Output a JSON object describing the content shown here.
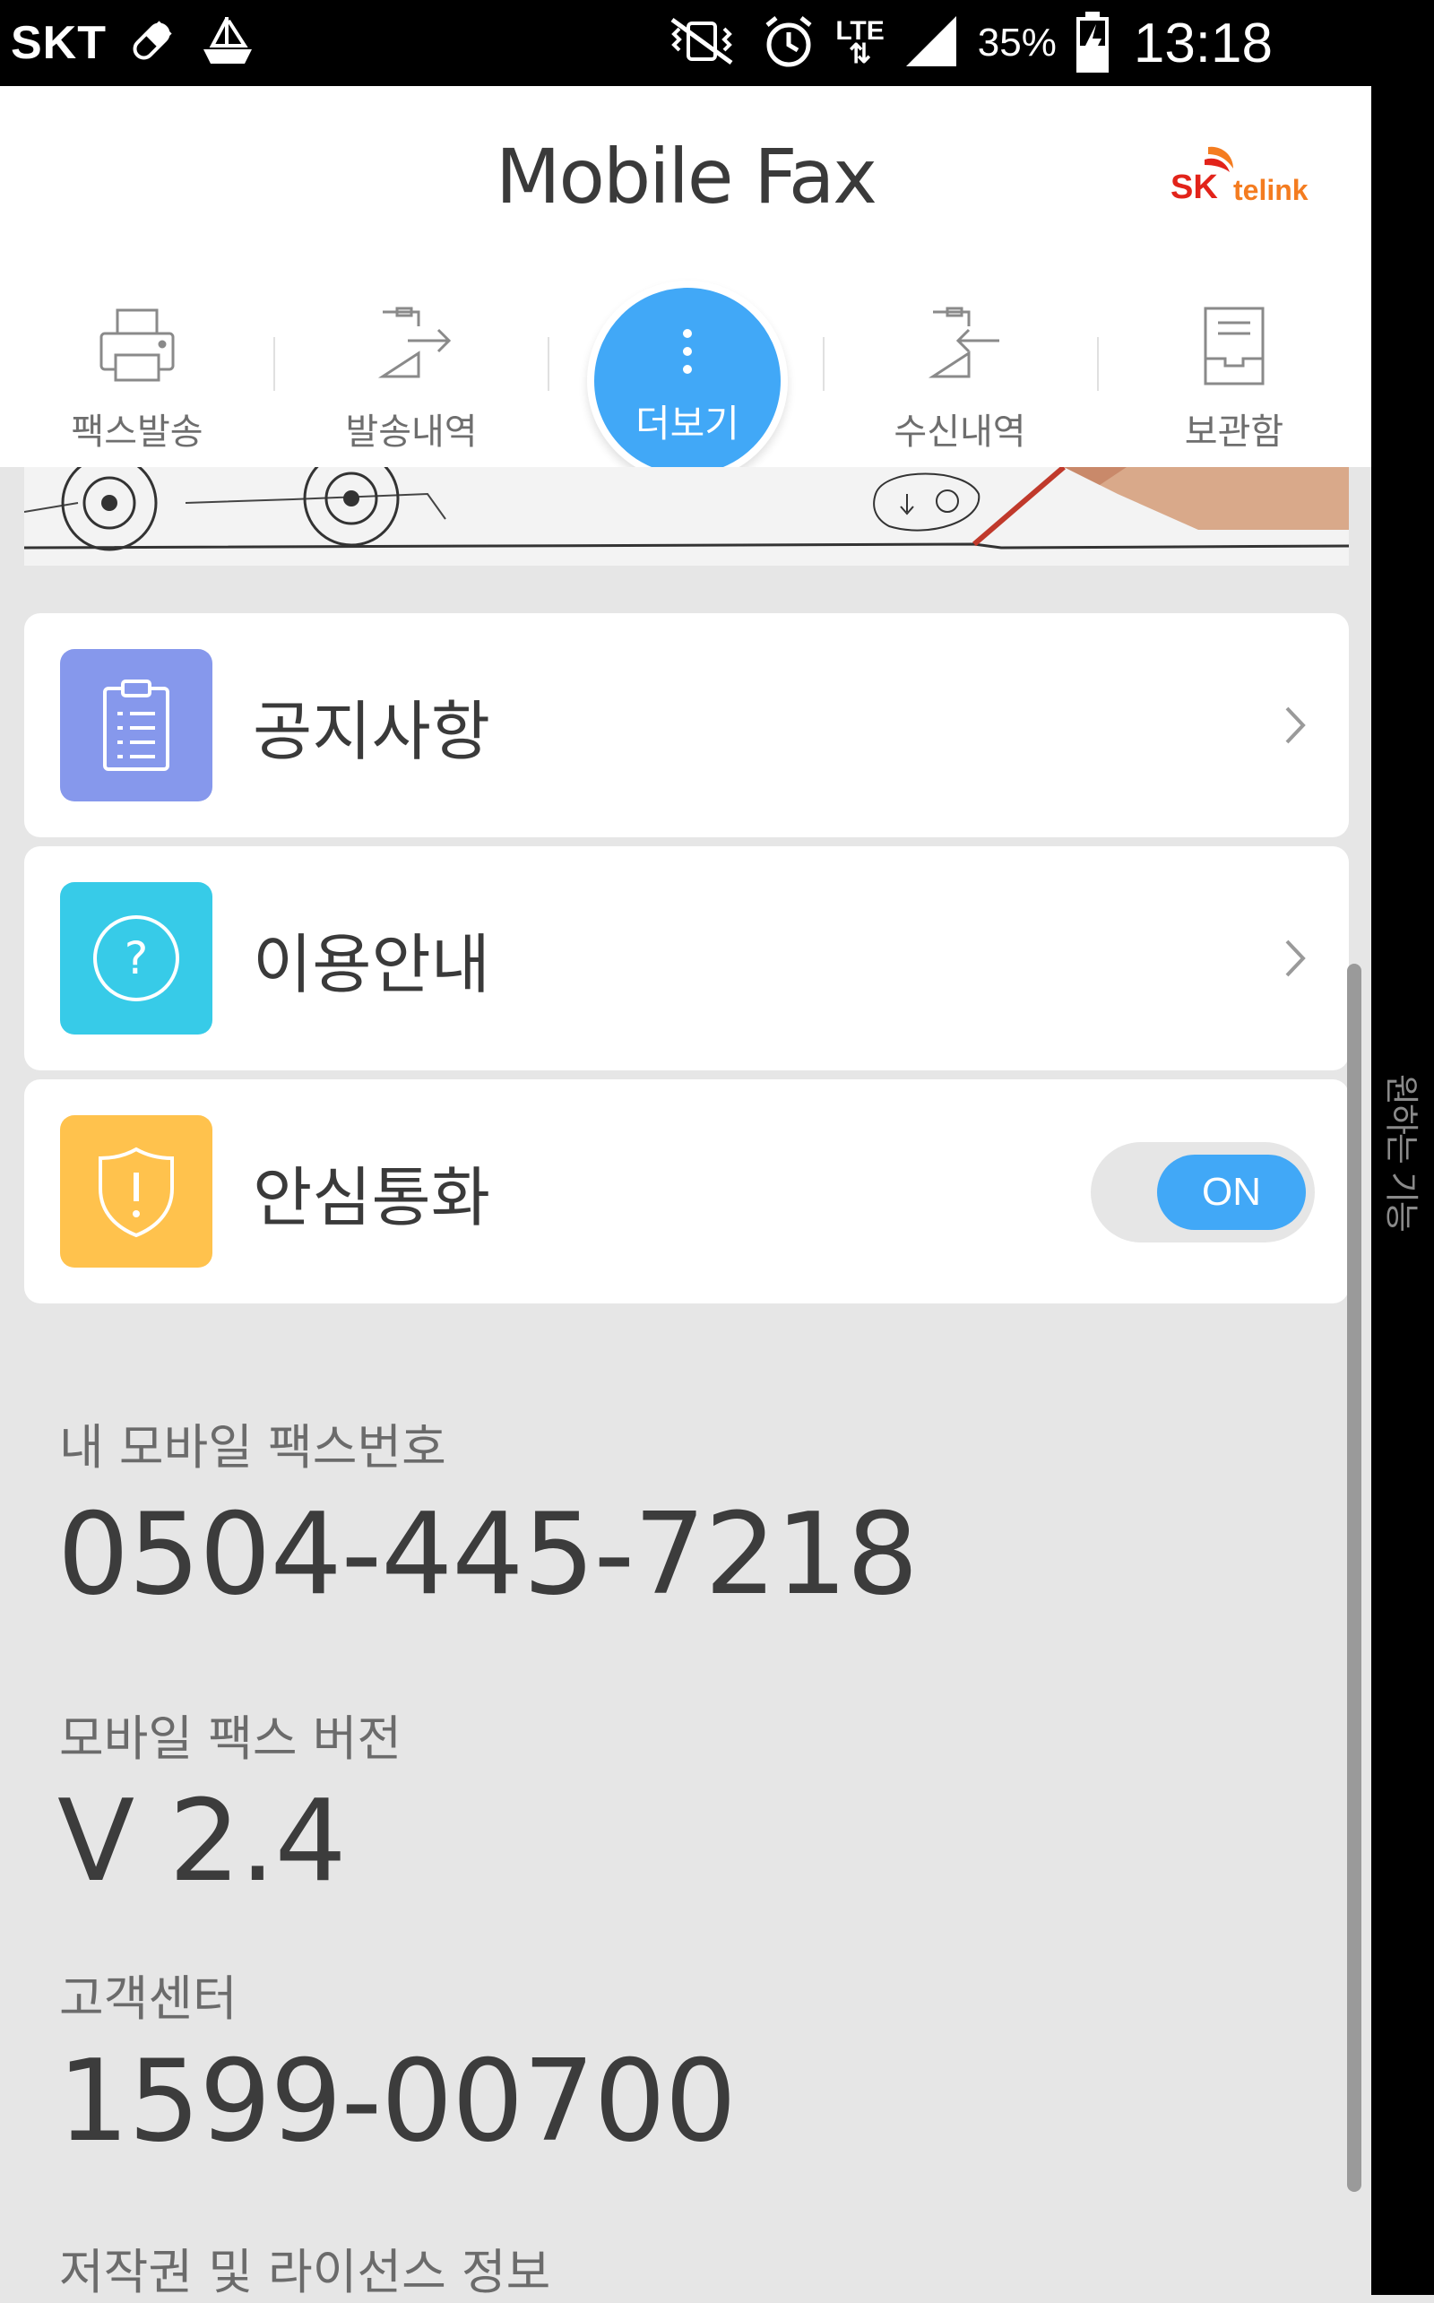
{
  "status_bar": {
    "carrier": "SKT",
    "network": "LTE",
    "battery": "35%",
    "time": "13:18"
  },
  "side_handle_label": "원하는 기능",
  "header": {
    "title": "Mobile Fax",
    "logo_text_sk": "SK",
    "logo_text_telink": "telink"
  },
  "tabs": [
    {
      "label": "팩스발송",
      "icon": "printer-icon"
    },
    {
      "label": "발송내역",
      "icon": "outbox-icon"
    },
    {
      "label": "더보기",
      "icon": "more-vertical-icon",
      "active": true
    },
    {
      "label": "수신내역",
      "icon": "inbox-icon"
    },
    {
      "label": "보관함",
      "icon": "archive-icon"
    }
  ],
  "menu": [
    {
      "label": "공지사항",
      "icon": "clipboard-icon",
      "color": "#8698ec"
    },
    {
      "label": "이용안내",
      "icon": "help-circle-icon",
      "color": "#37cbe8"
    },
    {
      "label": "안심통화",
      "icon": "shield-alert-icon",
      "color": "#ffc24d",
      "toggle": "ON"
    }
  ],
  "info": {
    "fax_number_label": "내 모바일 팩스번호",
    "fax_number": "0504-445-7218",
    "version_label": "모바일 팩스 버전",
    "version": "V 2.4",
    "support_label": "고객센터",
    "support_number": "1599-00700",
    "license_label": "저작권 및 라이선스 정보"
  },
  "colors": {
    "accent": "#41a8f7",
    "background": "#e6e6e6"
  }
}
